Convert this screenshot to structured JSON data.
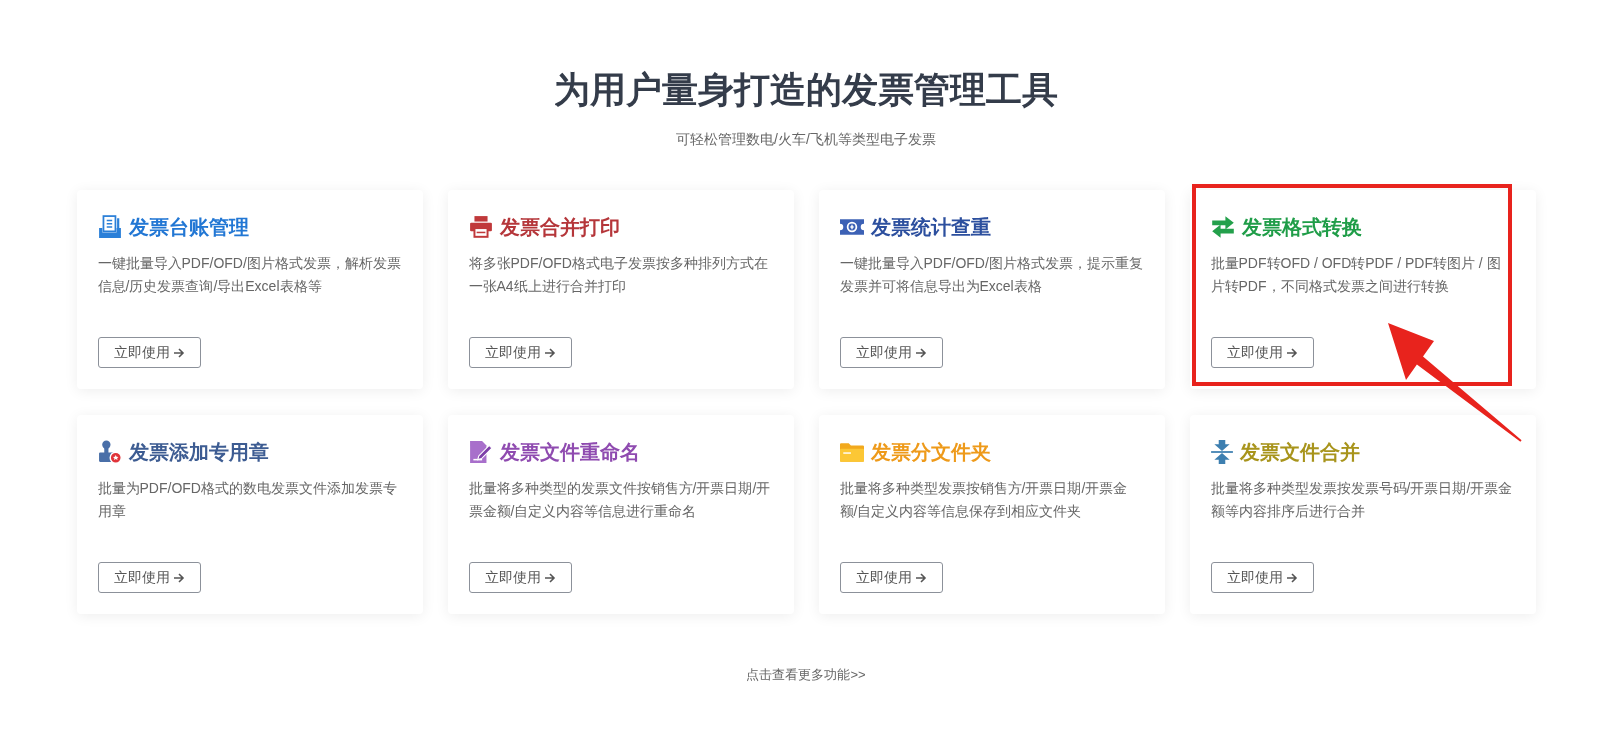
{
  "header": {
    "title": "为用户量身打造的发票管理工具",
    "subtitle": "可轻松管理数电/火车/飞机等类型电子发票"
  },
  "cards": [
    {
      "title": "发票台账管理",
      "color": "#2277d4",
      "description": "一键批量导入PDF/OFD/图片格式发票，解析发票信息/历史发票查询/导出Excel表格等",
      "button": "立即使用",
      "highlighted": false
    },
    {
      "title": "发票合并打印",
      "color": "#b5363a",
      "description": "将多张PDF/OFD格式电子发票按多种排列方式在一张A4纸上进行合并打印",
      "button": "立即使用",
      "highlighted": false
    },
    {
      "title": "发票统计查重",
      "color": "#2c4f9e",
      "description": "一键批量导入PDF/OFD/图片格式发票，提示重复发票并可将信息导出为Excel表格",
      "button": "立即使用",
      "highlighted": false
    },
    {
      "title": "发票格式转换",
      "color": "#1f9d48",
      "description": "批量PDF转OFD / OFD转PDF / PDF转图片 / 图片转PDF，不同格式发票之间进行转换",
      "button": "立即使用",
      "highlighted": true
    },
    {
      "title": "发票添加专用章",
      "color": "#3d5c92",
      "description": "批量为PDF/OFD格式的数电发票文件添加发票专用章",
      "button": "立即使用",
      "highlighted": false
    },
    {
      "title": "发票文件重命名",
      "color": "#8f4bb0",
      "description": "批量将多种类型的发票文件按销售方/开票日期/开票金额/自定义内容等信息进行重命名",
      "button": "立即使用",
      "highlighted": false
    },
    {
      "title": "发票分文件夹",
      "color": "#ee9a1a",
      "description": "批量将多种类型发票按销售方/开票日期/开票金额/自定义内容等信息保存到相应文件夹",
      "button": "立即使用",
      "highlighted": false
    },
    {
      "title": "发票文件合并",
      "color": "#a8941c",
      "description": "批量将多种类型发票按发票号码/开票日期/开票金额等内容排序后进行合并",
      "button": "立即使用",
      "highlighted": false
    }
  ],
  "more_link": "点击查看更多功能>>"
}
